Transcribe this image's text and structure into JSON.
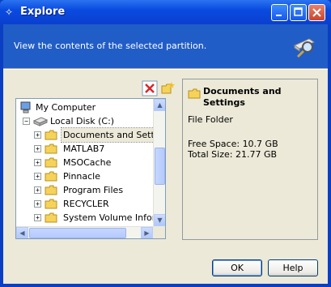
{
  "window": {
    "title": "Explore"
  },
  "header": {
    "text": "View the contents of the selected partition."
  },
  "tree": {
    "root": "My Computer",
    "drive": "Local Disk (C:)",
    "folders": [
      "Documents and Settings",
      "MATLAB7",
      "MSOCache",
      "Pinnacle",
      "Program Files",
      "RECYCLER",
      "System Volume Information"
    ]
  },
  "info": {
    "title": "Documents and Settings",
    "type": "File Folder",
    "free_space": "Free Space: 10.7 GB",
    "total_size": "Total Size: 21.77 GB"
  },
  "buttons": {
    "ok": "OK",
    "help": "Help"
  },
  "colors": {
    "titlebar": "#0a4be0",
    "header": "#215dc6",
    "dialog": "#ece9d8",
    "folder": "#f5d35a"
  }
}
